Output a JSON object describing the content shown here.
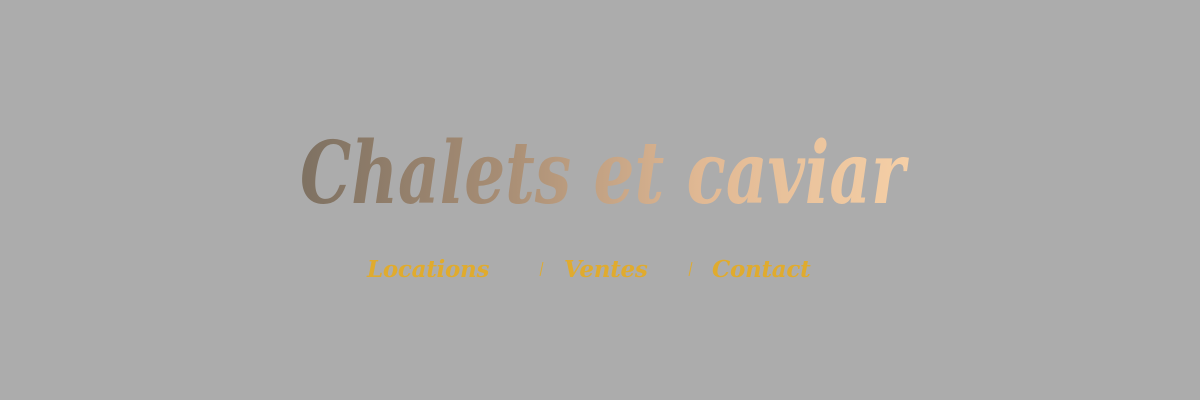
{
  "brand": {
    "logo_text": "Chalets et caviar",
    "logo_gradient": [
      "#7e7162",
      "#a78d74",
      "#e1b994",
      "#f5cfa6"
    ]
  },
  "nav": {
    "items": [
      {
        "label": "Locations"
      },
      {
        "label": "Ventes"
      },
      {
        "label": "Contact"
      }
    ],
    "link_color": "#e0ab2e"
  },
  "page": {
    "background": "#acacac"
  }
}
